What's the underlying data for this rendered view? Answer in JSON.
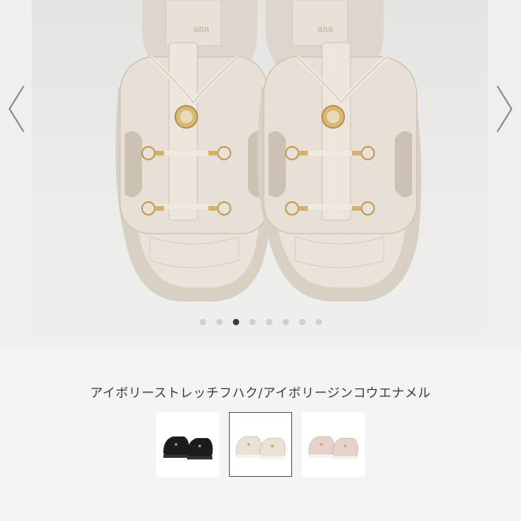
{
  "gallery": {
    "image_description": "",
    "prev_icon": "chevron-left-icon",
    "next_icon": "chevron-right-icon",
    "page_count": 8,
    "active_index": 2
  },
  "product": {
    "name": "アイボリーストレッチフハク/アイボリージンコウエナメル"
  },
  "swatches": [
    {
      "color_name": "black",
      "swatch_color": "#1c1c1c",
      "selected": false
    },
    {
      "color_name": "ivory",
      "swatch_color": "#e9e2d6",
      "selected": true
    },
    {
      "color_name": "pink",
      "swatch_color": "#e6d2cc",
      "selected": false
    }
  ],
  "colors": {
    "background": "#f4f4f4",
    "dot_active": "#3a3a3a",
    "dot_inactive": "#cfcfcf",
    "text": "#3c3c3c"
  }
}
